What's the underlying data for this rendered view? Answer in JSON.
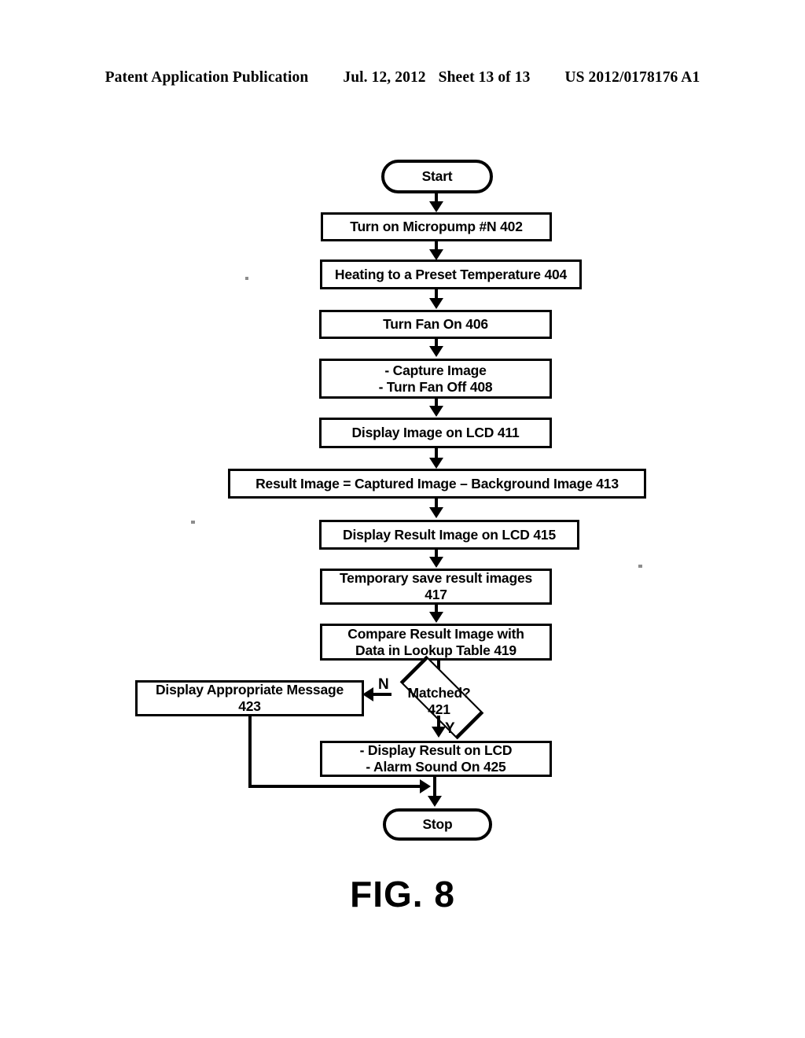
{
  "header": {
    "publication": "Patent Application Publication",
    "date": "Jul. 12, 2012",
    "sheet": "Sheet 13 of 13",
    "patent_number": "US 2012/0178176 A1"
  },
  "figure": {
    "caption": "FIG. 8",
    "nodes": {
      "start": "Start",
      "step_402": "Turn on Micropump #N 402",
      "step_404": "Heating to a Preset Temperature 404",
      "step_406": "Turn Fan On 406",
      "step_408": "- Capture Image\n- Turn Fan Off 408",
      "step_411": "Display Image on LCD 411",
      "step_413": "Result Image = Captured Image – Background Image 413",
      "step_415": "Display Result Image on LCD 415",
      "step_417": "Temporary save result images\n417",
      "step_419": "Compare Result Image with\nData in Lookup Table 419",
      "decision_421_label": "Matched?",
      "decision_421_number": "421",
      "step_423": "Display Appropriate Message\n423",
      "step_425": "- Display Result on LCD\n- Alarm Sound On 425",
      "stop": "Stop"
    },
    "branches": {
      "no": "N",
      "yes": "Y"
    },
    "colors": {
      "ink": "#000000",
      "paper": "#ffffff"
    }
  }
}
